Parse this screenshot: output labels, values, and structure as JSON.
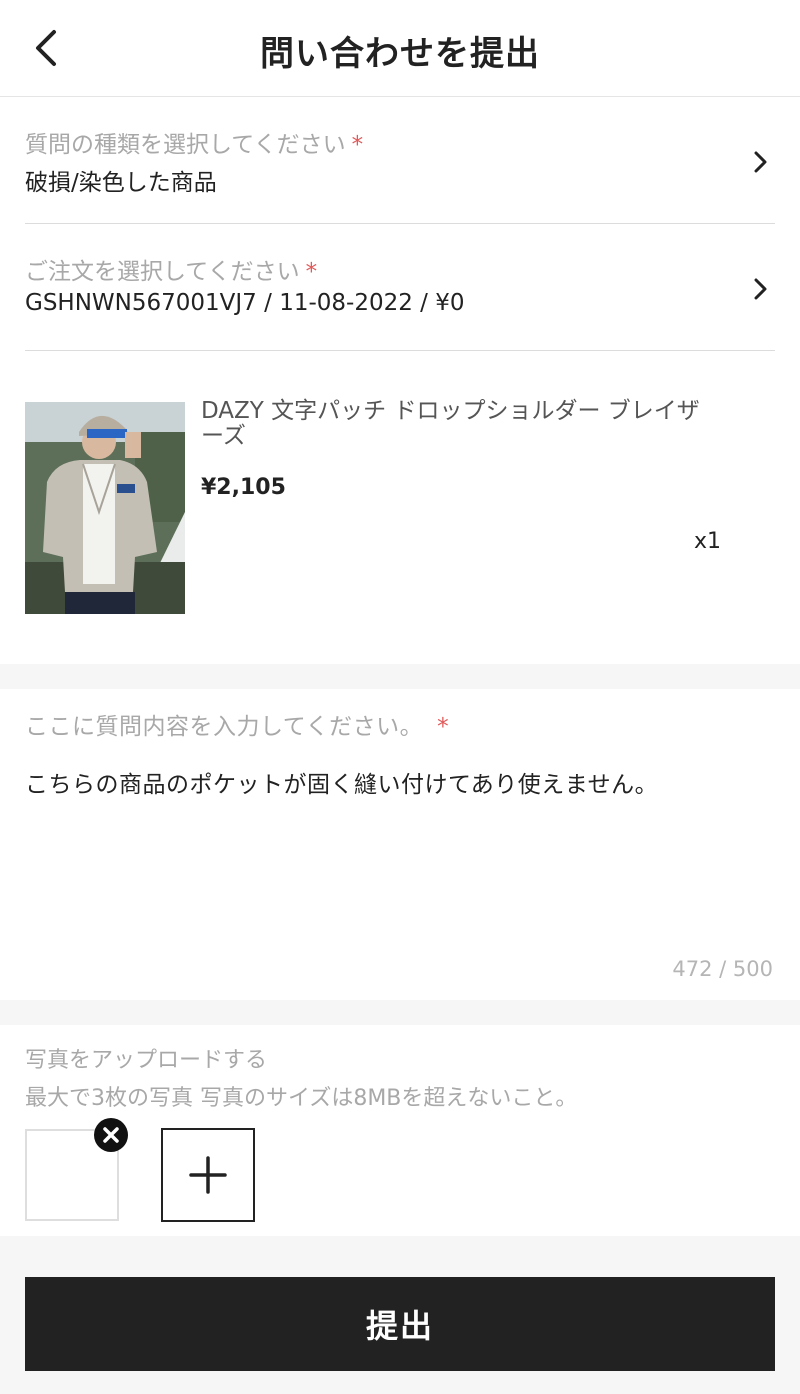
{
  "header": {
    "title": "問い合わせを提出",
    "back_icon": "chevron-left-icon"
  },
  "question_type": {
    "label": "質問の種類を選択してください",
    "required_mark": "*",
    "value": "破損/染色した商品"
  },
  "order": {
    "label": "ご注文を選択してください",
    "required_mark": "*",
    "value": "GSHNWN567001VJ7 / 11-08-2022 / ¥0"
  },
  "product": {
    "name": "DAZY 文字パッチ ドロップショルダー ブレイザーズ",
    "price": "¥2,105",
    "quantity": "x1"
  },
  "question": {
    "label": "ここに質問内容を入力してください。",
    "required_mark": "*",
    "text": "こちらの商品のポケットが固く縫い付けてあり使えません。",
    "counter": "472 / 500"
  },
  "upload": {
    "title": "写真をアップロードする",
    "note": "最大で3枚の写真 写真のサイズは8MBを超えないこと。"
  },
  "submit_label": "提出",
  "colors": {
    "required": "#e05a5a",
    "button": "#222222",
    "muted_text": "#a8a8a8"
  }
}
